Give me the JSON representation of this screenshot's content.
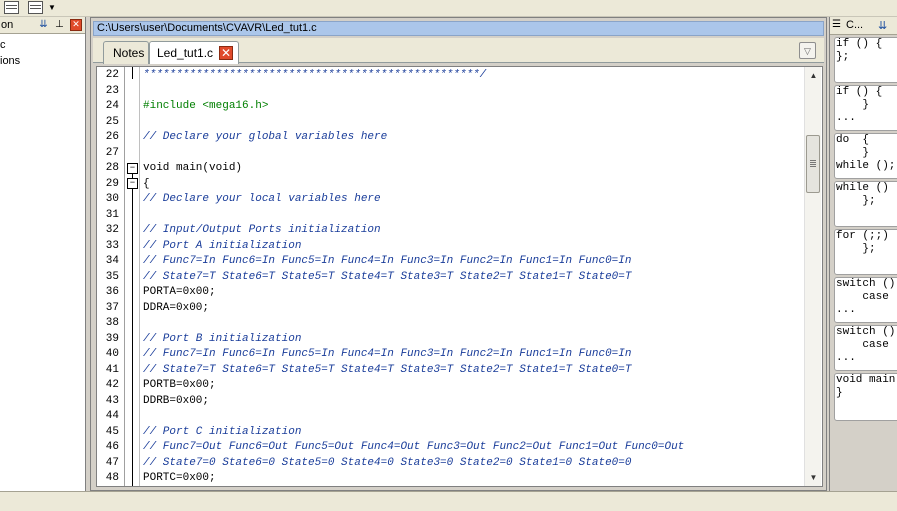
{
  "left_panel": {
    "header_title": "on",
    "items": [
      "c",
      "ions"
    ]
  },
  "editor": {
    "title": "C:\\Users\\user\\Documents\\CVAVR\\Led_tut1.c",
    "tabs": [
      {
        "label": "Notes",
        "active": false
      },
      {
        "label": "Led_tut1.c",
        "active": true
      }
    ],
    "lines": [
      {
        "n": "22",
        "text": "***************************************************/",
        "kind": "cm"
      },
      {
        "n": "23",
        "text": "",
        "kind": "nm"
      },
      {
        "n": "24",
        "text": "#include <mega16.h>",
        "kind": "pp"
      },
      {
        "n": "25",
        "text": "",
        "kind": "nm"
      },
      {
        "n": "26",
        "text": "// Declare your global variables here",
        "kind": "cm"
      },
      {
        "n": "27",
        "text": "",
        "kind": "nm"
      },
      {
        "n": "28",
        "text": "void main(void)",
        "kind": "nm"
      },
      {
        "n": "29",
        "text": "{",
        "kind": "nm"
      },
      {
        "n": "30",
        "text": "// Declare your local variables here",
        "kind": "cm"
      },
      {
        "n": "31",
        "text": "",
        "kind": "nm"
      },
      {
        "n": "32",
        "text": "// Input/Output Ports initialization",
        "kind": "cm"
      },
      {
        "n": "33",
        "text": "// Port A initialization",
        "kind": "cm"
      },
      {
        "n": "34",
        "text": "// Func7=In Func6=In Func5=In Func4=In Func3=In Func2=In Func1=In Func0=In",
        "kind": "cm"
      },
      {
        "n": "35",
        "text": "// State7=T State6=T State5=T State4=T State3=T State2=T State1=T State0=T",
        "kind": "cm"
      },
      {
        "n": "36",
        "text": "PORTA=0x00;",
        "kind": "nm"
      },
      {
        "n": "37",
        "text": "DDRA=0x00;",
        "kind": "nm"
      },
      {
        "n": "38",
        "text": "",
        "kind": "nm"
      },
      {
        "n": "39",
        "text": "// Port B initialization",
        "kind": "cm"
      },
      {
        "n": "40",
        "text": "// Func7=In Func6=In Func5=In Func4=In Func3=In Func2=In Func1=In Func0=In",
        "kind": "cm"
      },
      {
        "n": "41",
        "text": "// State7=T State6=T State5=T State4=T State3=T State2=T State1=T State0=T",
        "kind": "cm"
      },
      {
        "n": "42",
        "text": "PORTB=0x00;",
        "kind": "nm"
      },
      {
        "n": "43",
        "text": "DDRB=0x00;",
        "kind": "nm"
      },
      {
        "n": "44",
        "text": "",
        "kind": "nm"
      },
      {
        "n": "45",
        "text": "// Port C initialization",
        "kind": "cm"
      },
      {
        "n": "46",
        "text": "// Func7=Out Func6=Out Func5=Out Func4=Out Func3=Out Func2=Out Func1=Out Func0=Out",
        "kind": "cm"
      },
      {
        "n": "47",
        "text": "// State7=0 State6=0 State5=0 State4=0 State3=0 State2=0 State1=0 State0=0",
        "kind": "cm"
      },
      {
        "n": "48",
        "text": "PORTC=0x00;",
        "kind": "nm"
      }
    ]
  },
  "right_panel": {
    "header_title": "C...",
    "snippets": [
      "if () {\n};",
      "if () {\n    }\n...",
      "do  {\n    }\nwhile ();",
      "while ()\n    };",
      "for (;;)\n    };",
      "switch ()\n    case\n...",
      "switch ()\n    case\n...",
      "void main\n}"
    ]
  },
  "colors": {
    "comment": "#1a3d9a",
    "preprocessor": "#007f00",
    "title_bar": "#abc6ea"
  }
}
